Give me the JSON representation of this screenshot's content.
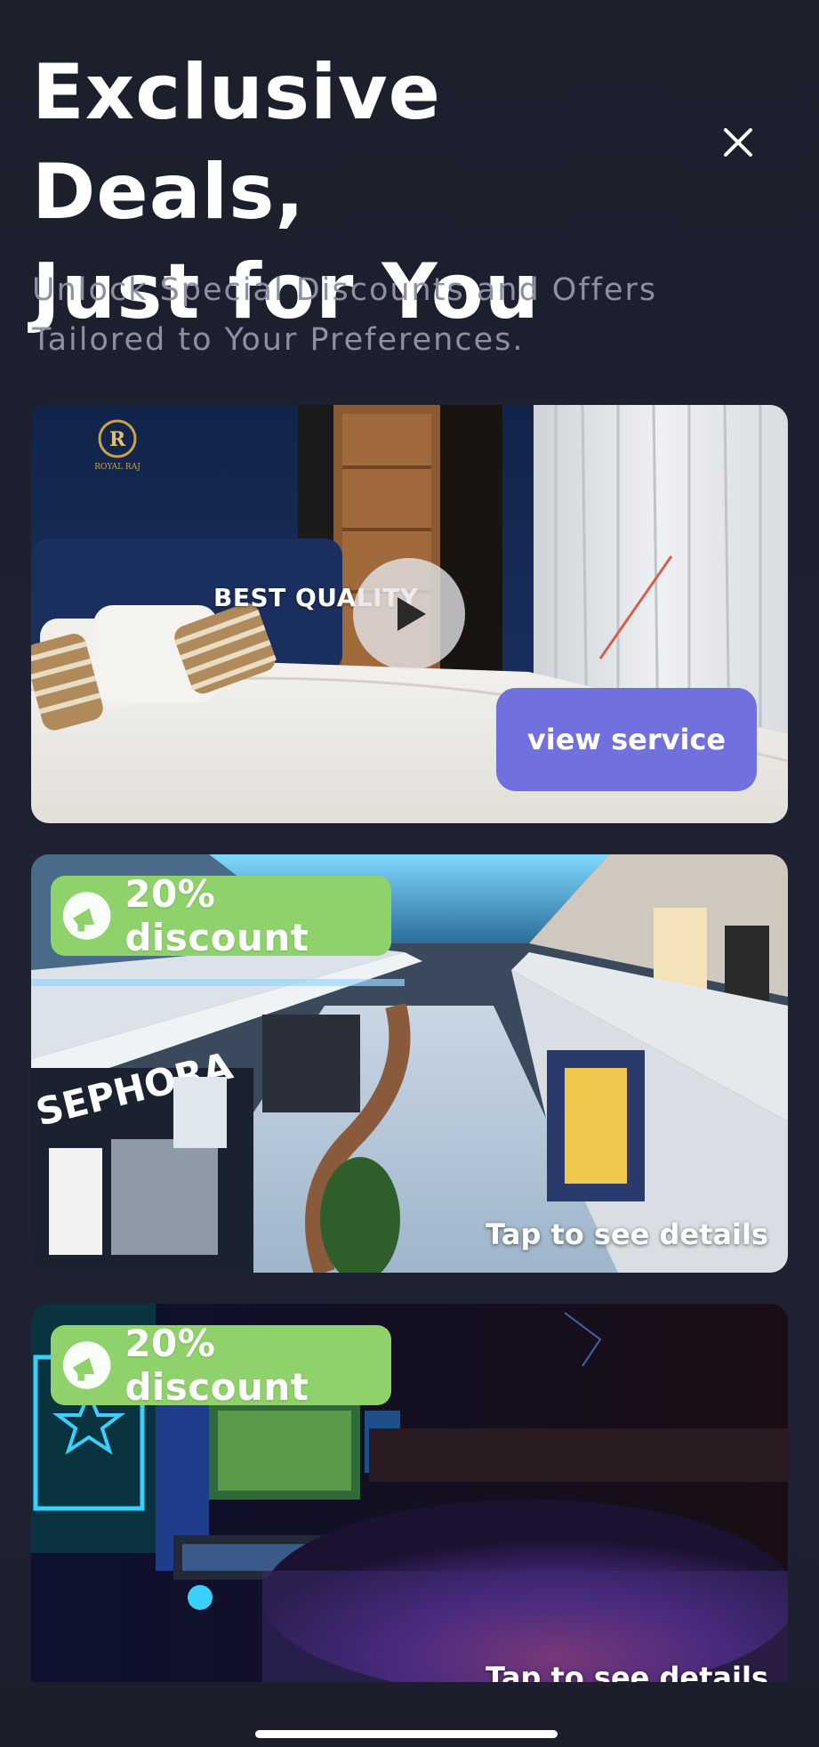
{
  "header": {
    "title_line1": "Exclusive Deals,",
    "title_line2": "Just for You",
    "subtitle": "Unlock Special Discounts and Offers Tailored to Your Preferences.",
    "close_icon": "close-icon"
  },
  "cards": [
    {
      "image": "hotel-bedroom",
      "overlay_text": "BEST QUALITY",
      "logo_text": "ROYAL RAJ",
      "play_icon": "play-icon",
      "button_label": "view service",
      "button_color": "#7070de"
    },
    {
      "image": "shopping-mall",
      "badge_label": "20% discount",
      "badge_icon": "megaphone-icon",
      "badge_color": "#8fd16a",
      "tap_label": "Tap to see details"
    },
    {
      "image": "esports-arena",
      "badge_label": "20% discount",
      "badge_icon": "megaphone-icon",
      "badge_color": "#8fd16a",
      "tap_label": "Tap to see details"
    }
  ]
}
